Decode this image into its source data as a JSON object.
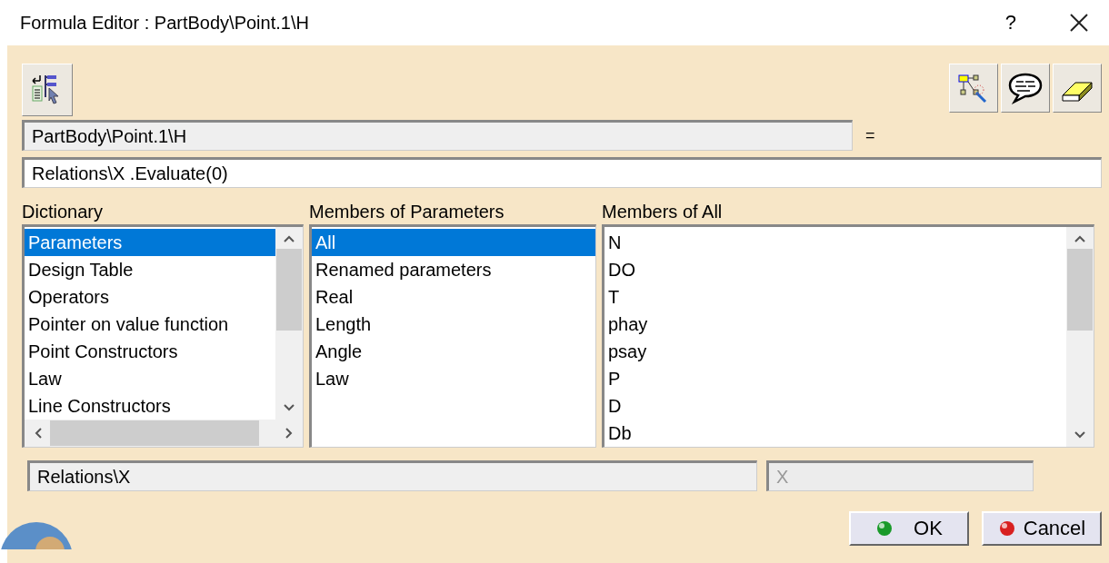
{
  "window": {
    "title": "Formula Editor : PartBody\\Point.1\\H",
    "help": "?"
  },
  "parameter_field": {
    "value": "PartBody\\Point.1\\H"
  },
  "equals": "=",
  "formula_field": {
    "value": "Relations\\X .Evaluate(0)"
  },
  "lists": [
    {
      "heading": "Dictionary",
      "items": [
        {
          "label": "Parameters",
          "selected": true
        },
        {
          "label": "Design Table",
          "selected": false
        },
        {
          "label": "Operators",
          "selected": false
        },
        {
          "label": "Pointer on value function",
          "selected": false
        },
        {
          "label": "Point Constructors",
          "selected": false
        },
        {
          "label": "Law",
          "selected": false
        },
        {
          "label": "Line Constructors",
          "selected": false
        }
      ],
      "vscroll": true,
      "hscroll": true
    },
    {
      "heading": "Members of Parameters",
      "items": [
        {
          "label": "All",
          "selected": true
        },
        {
          "label": "Renamed parameters",
          "selected": false
        },
        {
          "label": "Real",
          "selected": false
        },
        {
          "label": "Length",
          "selected": false
        },
        {
          "label": "Angle",
          "selected": false
        },
        {
          "label": "Law",
          "selected": false
        }
      ],
      "vscroll": false,
      "hscroll": false
    },
    {
      "heading": "Members of All",
      "items": [
        {
          "label": "N",
          "selected": false
        },
        {
          "label": "DO",
          "selected": false
        },
        {
          "label": "T",
          "selected": false
        },
        {
          "label": "phay",
          "selected": false
        },
        {
          "label": "psay",
          "selected": false
        },
        {
          "label": "P",
          "selected": false
        },
        {
          "label": "D",
          "selected": false
        },
        {
          "label": "Db",
          "selected": false
        }
      ],
      "vscroll": true,
      "hscroll": false
    }
  ],
  "path_field": {
    "value": "Relations\\X",
    "disabled": false
  },
  "name_field": {
    "value": "X",
    "disabled": true
  },
  "buttons": [
    {
      "label": "OK",
      "kind": "ok"
    },
    {
      "label": "Cancel",
      "kind": "cancel"
    }
  ]
}
